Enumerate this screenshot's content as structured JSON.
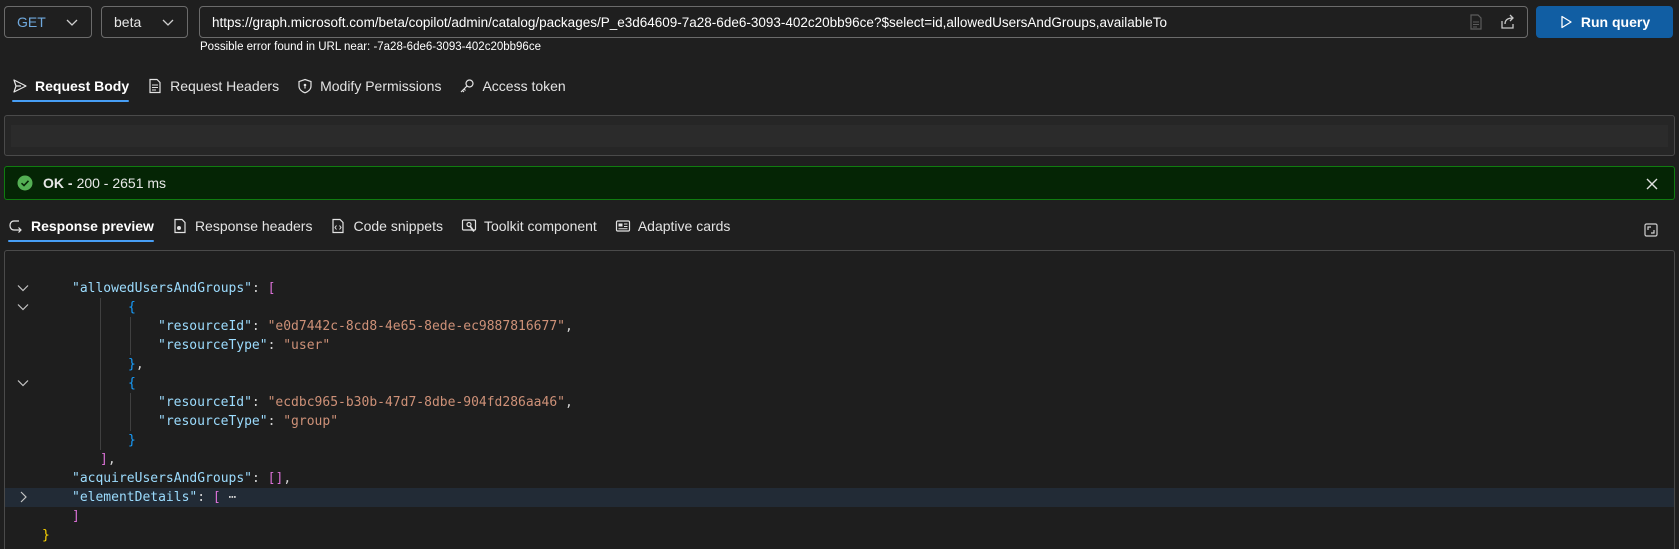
{
  "query": {
    "method": "GET",
    "version": "beta",
    "url": "https://graph.microsoft.com/beta/copilot/admin/catalog/packages/P_e3d64609-7a28-6de6-3093-402c20bb96ce?$select=id,allowedUsersAndGroups,availableTo",
    "hint": "Possible error found in URL near: -7a28-6de6-3093-402c20bb96ce",
    "run_label": "Run query"
  },
  "request_tabs": [
    {
      "label": "Request Body",
      "active": true
    },
    {
      "label": "Request Headers"
    },
    {
      "label": "Modify Permissions"
    },
    {
      "label": "Access token"
    }
  ],
  "status": {
    "ok": "OK -",
    "detail": "200 - 2651 ms"
  },
  "response_tabs": [
    {
      "label": "Response preview",
      "active": true
    },
    {
      "label": "Response headers"
    },
    {
      "label": "Code snippets"
    },
    {
      "label": "Toolkit component"
    },
    {
      "label": "Adaptive cards"
    }
  ],
  "response_lines": [
    {
      "key": "\"allowedUsersAndGroups\"",
      "punct": ": ",
      "bracket": "["
    },
    {
      "bracket": "{"
    },
    {
      "key": "\"resourceId\"",
      "punct": ": ",
      "value": "\"e0d7442c-8cd8-4e65-8ede-ec9887816677\"",
      "tail": ","
    },
    {
      "key": "\"resourceType\"",
      "punct": ": ",
      "value": "\"user\""
    },
    {
      "bracket": "}",
      "tail": ","
    },
    {
      "bracket": "{"
    },
    {
      "key": "\"resourceId\"",
      "punct": ": ",
      "value": "\"ecdbc965-b30b-47d7-8dbe-904fd286aa46\"",
      "tail": ","
    },
    {
      "key": "\"resourceType\"",
      "punct": ": ",
      "value": "\"group\""
    },
    {
      "bracket": "}"
    },
    {
      "bracket": "]",
      "tail": ","
    },
    {
      "key": "\"acquireUsersAndGroups\"",
      "punct": ": ",
      "bracket": "[]",
      "tail": ","
    },
    {
      "key": "\"elementDetails\"",
      "punct": ": ",
      "bracket": "[",
      "tail": " ⋯"
    },
    {
      "bracket": "]"
    },
    {
      "bracket": "}"
    }
  ]
}
